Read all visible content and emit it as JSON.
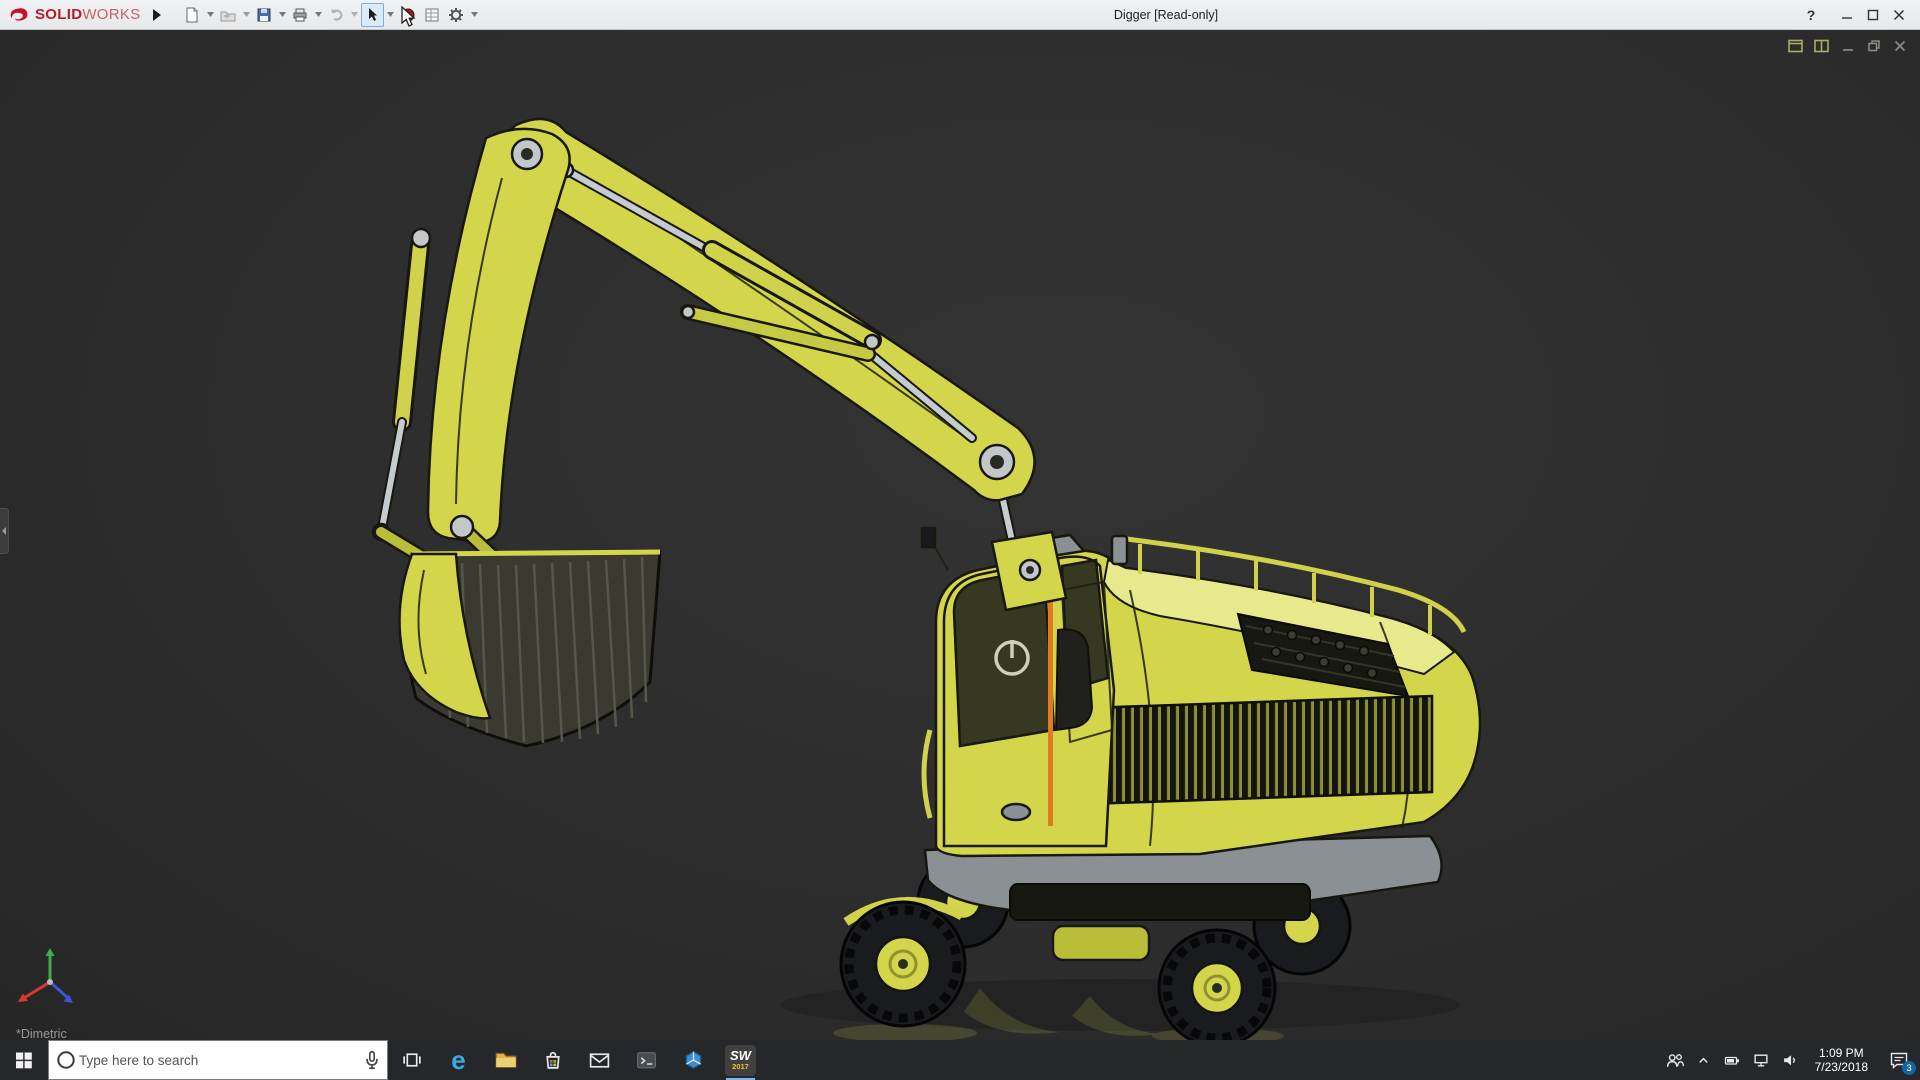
{
  "titlebar": {
    "brand": {
      "name_bold": "SOLID",
      "name_light": "WORKS"
    },
    "title": "Digger [Read-only]",
    "help_glyph": "?",
    "toolbar_icons": [
      "flyout-expand",
      "new-document",
      "open",
      "save",
      "print",
      "undo",
      "select-arrow",
      "appearance",
      "properties",
      "options-gear"
    ]
  },
  "viewport": {
    "view_label": "*Dimetric",
    "doc_controls": [
      "pane-left",
      "pane-right",
      "minimize",
      "restore",
      "close"
    ]
  },
  "taskbar": {
    "search_placeholder": "Type here to search",
    "edge_glyph": "e",
    "solidworks_badge": {
      "line1": "SW",
      "line2": "2017"
    },
    "icons": [
      "start",
      "cortana-search",
      "task-view",
      "edge",
      "file-explorer",
      "store",
      "mail",
      "console",
      "edrawings",
      "solidworks-2017"
    ],
    "tray": {
      "icons": [
        "people",
        "chevron-up",
        "battery",
        "network",
        "volume",
        "action-center"
      ],
      "time": "1:09 PM",
      "date": "7/23/2018",
      "notification_count": "3"
    }
  },
  "colors": {
    "machine-yellow": "#d3d64a",
    "machine-yellow-dark": "#b9bd38",
    "machine-yellow-light": "#e6e98c",
    "viewport-bg": "#2d2d2d",
    "titlebar-bg": "#f1f2f4",
    "taskbar-bg": "#26272b",
    "brand-red": "#b01f2e",
    "accent-orange": "#e5791e",
    "badge-blue": "#1464a0"
  }
}
